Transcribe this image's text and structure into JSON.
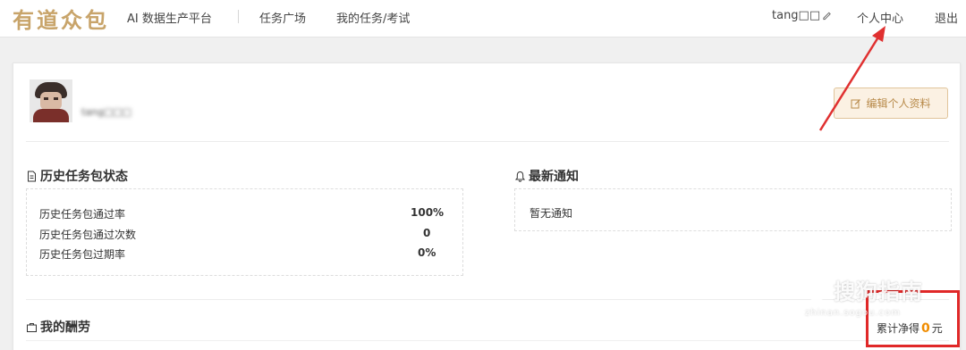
{
  "header": {
    "logo": "有道众包",
    "nav": [
      "AI 数据生产平台",
      "任务广场",
      "我的任务/考试"
    ],
    "username": "tang□□",
    "personal_center": "个人中心",
    "logout": "退出"
  },
  "profile": {
    "username": "tang□□□",
    "edit_label": "编辑个人资料"
  },
  "history": {
    "title": "历史任务包状态",
    "rows": [
      {
        "label": "历史任务包通过率",
        "value": "100%"
      },
      {
        "label": "历史任务包通过次数",
        "value": "0"
      },
      {
        "label": "历史任务包过期率",
        "value": "0%"
      }
    ]
  },
  "notifications": {
    "title": "最新通知",
    "empty": "暂无通知"
  },
  "reward": {
    "title": "我的酬劳",
    "prefix": "累计净得",
    "amount": "0",
    "unit": "元"
  },
  "watermark": {
    "main": "搜狗指南",
    "sub": "zhinan.sogou.com"
  },
  "colors": {
    "brand": "#c8a46a",
    "highlight_red": "#e02828",
    "amount_orange": "#f08c00"
  }
}
